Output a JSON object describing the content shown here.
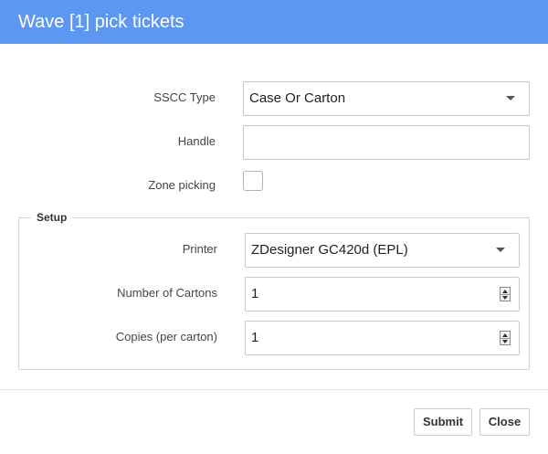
{
  "dialog": {
    "title": "Wave [1] pick tickets"
  },
  "form": {
    "sscc_type": {
      "label": "SSCC Type",
      "value": "Case Or Carton"
    },
    "handle": {
      "label": "Handle",
      "value": ""
    },
    "zone_picking": {
      "label": "Zone picking",
      "checked": false
    }
  },
  "setup": {
    "legend": "Setup",
    "printer": {
      "label": "Printer",
      "value": "ZDesigner GC420d (EPL)"
    },
    "number_of_cartons": {
      "label": "Number of Cartons",
      "value": "1"
    },
    "copies_per_carton": {
      "label": "Copies (per carton)",
      "value": "1"
    }
  },
  "buttons": {
    "submit_label": "Submit",
    "close_label": "Close"
  },
  "colors": {
    "header_bg": "#5e97f2",
    "header_text": "#ffffff"
  },
  "icons": {
    "select_caret": "chevron-down-icon",
    "number_spinner": "spinner-icon"
  }
}
